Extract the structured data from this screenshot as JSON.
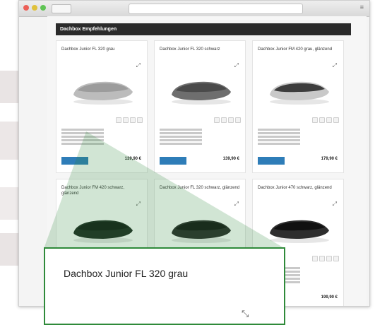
{
  "section": {
    "header": "Dachbox Empfehlungen"
  },
  "products": [
    {
      "title": "Dachbox Junior FL 320 grau",
      "price": "139,90 €",
      "body_color": "#bcbcbc",
      "lid_color": "#9c9c9c"
    },
    {
      "title": "Dachbox Junior FL 320 schwarz",
      "price": "139,90 €",
      "body_color": "#6e6e6e",
      "lid_color": "#4a4a4a"
    },
    {
      "title": "Dachbox Junior FM 420 grau, glänzend",
      "price": "179,90 €",
      "body_color": "#c9c9c9",
      "lid_color": "#3d3d3d"
    },
    {
      "title": "Dachbox Junior FM 420 schwarz, glänzend",
      "price": "",
      "body_color": "#1e2a22",
      "lid_color": "#121a15"
    },
    {
      "title": "Dachbox Junior FL 320 schwarz, glänzend",
      "price": "",
      "body_color": "#2a2a2a",
      "lid_color": "#141414"
    },
    {
      "title": "Dachbox Junior 470 schwarz, glänzend",
      "price": "199,90 €",
      "body_color": "#2e2e2e",
      "lid_color": "#111111"
    }
  ],
  "zoom": {
    "title": "Dachbox Junior FL 320 grau"
  },
  "colors": {
    "header_bg": "#2b2b2b",
    "button": "#2e7db8",
    "zoom_border": "#2f8a3a"
  }
}
